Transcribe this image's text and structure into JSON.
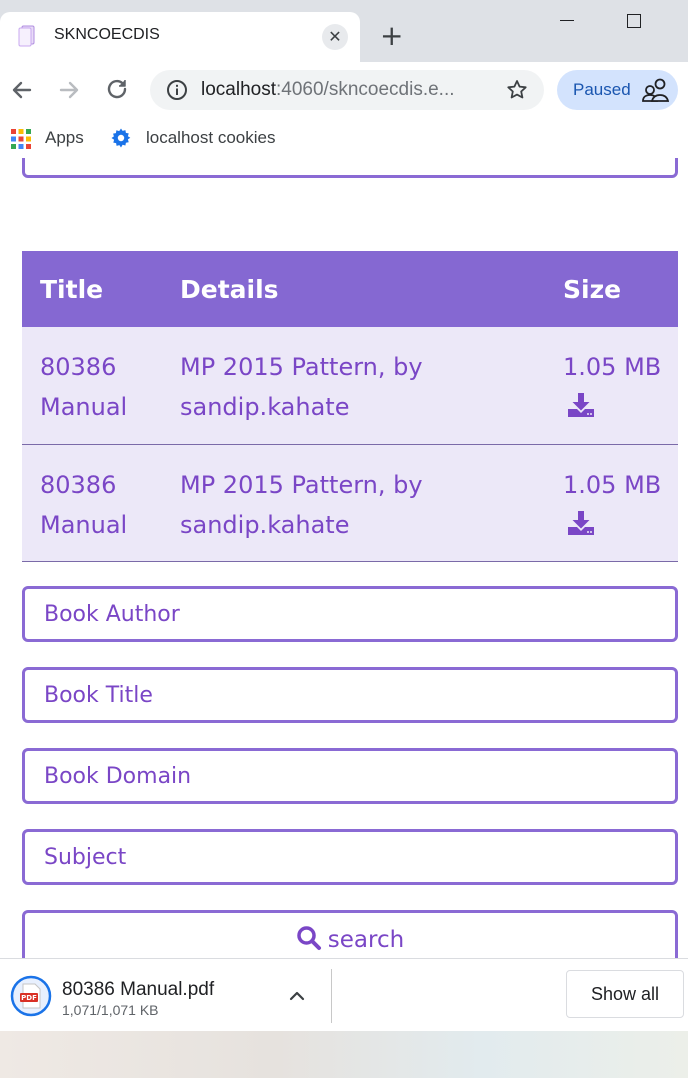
{
  "browser": {
    "tab_title": "SKNCOECDIS",
    "url_host": "localhost",
    "url_rest": ":4060/skncoecdis.e...",
    "profile_status": "Paused",
    "bookmarks": [
      {
        "label": "Apps"
      },
      {
        "label": "localhost cookies"
      }
    ]
  },
  "table": {
    "headers": {
      "title": "Title",
      "details": "Details",
      "size": "Size"
    },
    "rows": [
      {
        "title": "80386 Manual",
        "details": "MP 2015 Pattern, by sandip.kahate",
        "size": "1.05 MB"
      },
      {
        "title": "80386 Manual",
        "details": "MP 2015 Pattern, by sandip.kahate",
        "size": "1.05 MB"
      }
    ]
  },
  "form": {
    "author_placeholder": "Book Author",
    "title_placeholder": "Book Title",
    "domain_placeholder": "Book Domain",
    "subject_placeholder": "Subject",
    "search_label": "search"
  },
  "downloads": {
    "file_name": "80386 Manual.pdf",
    "file_progress": "1,071/1,071 KB",
    "show_all_label": "Show all"
  },
  "colors": {
    "accent": "#8568d2",
    "text_purple": "#7a46c6",
    "row_bg": "#ece8f8"
  }
}
